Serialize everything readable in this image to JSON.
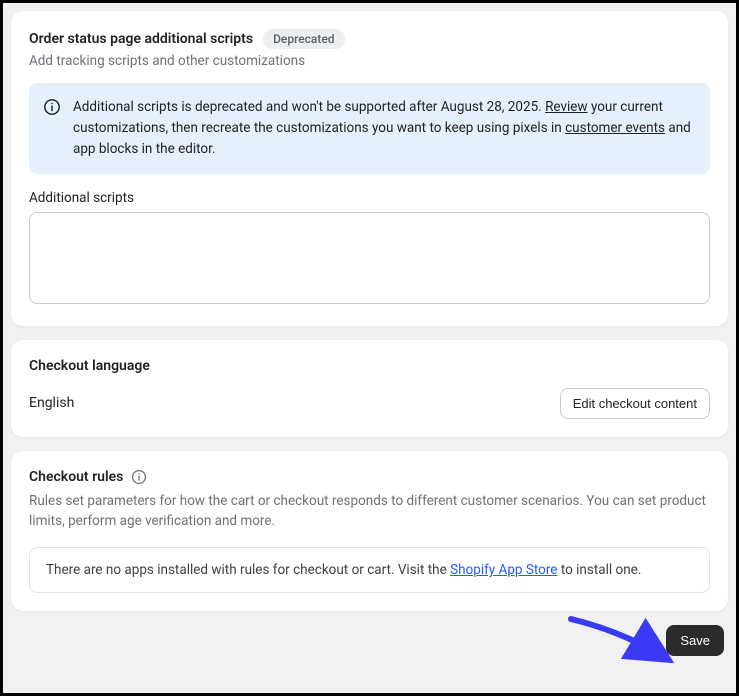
{
  "order_status": {
    "title": "Order status page additional scripts",
    "badge": "Deprecated",
    "subtitle": "Add tracking scripts and other customizations",
    "banner_pre": "Additional scripts is deprecated and won't be supported after August 28, 2025. ",
    "banner_review": "Review",
    "banner_mid": " your current customizations, then recreate the customizations you want to keep using pixels in ",
    "banner_link": "customer events",
    "banner_post": " and app blocks in the editor.",
    "field_label": "Additional scripts",
    "field_value": ""
  },
  "checkout_language": {
    "title": "Checkout language",
    "value": "English",
    "button": "Edit checkout content"
  },
  "checkout_rules": {
    "title": "Checkout rules",
    "desc": "Rules set parameters for how the cart or checkout responds to different customer scenarios. You can set product limits, perform age verification and more.",
    "notice_pre": "There are no apps installed with rules for checkout or cart. Visit the ",
    "notice_link": "Shopify App Store",
    "notice_post": " to install one."
  },
  "save_button": "Save"
}
